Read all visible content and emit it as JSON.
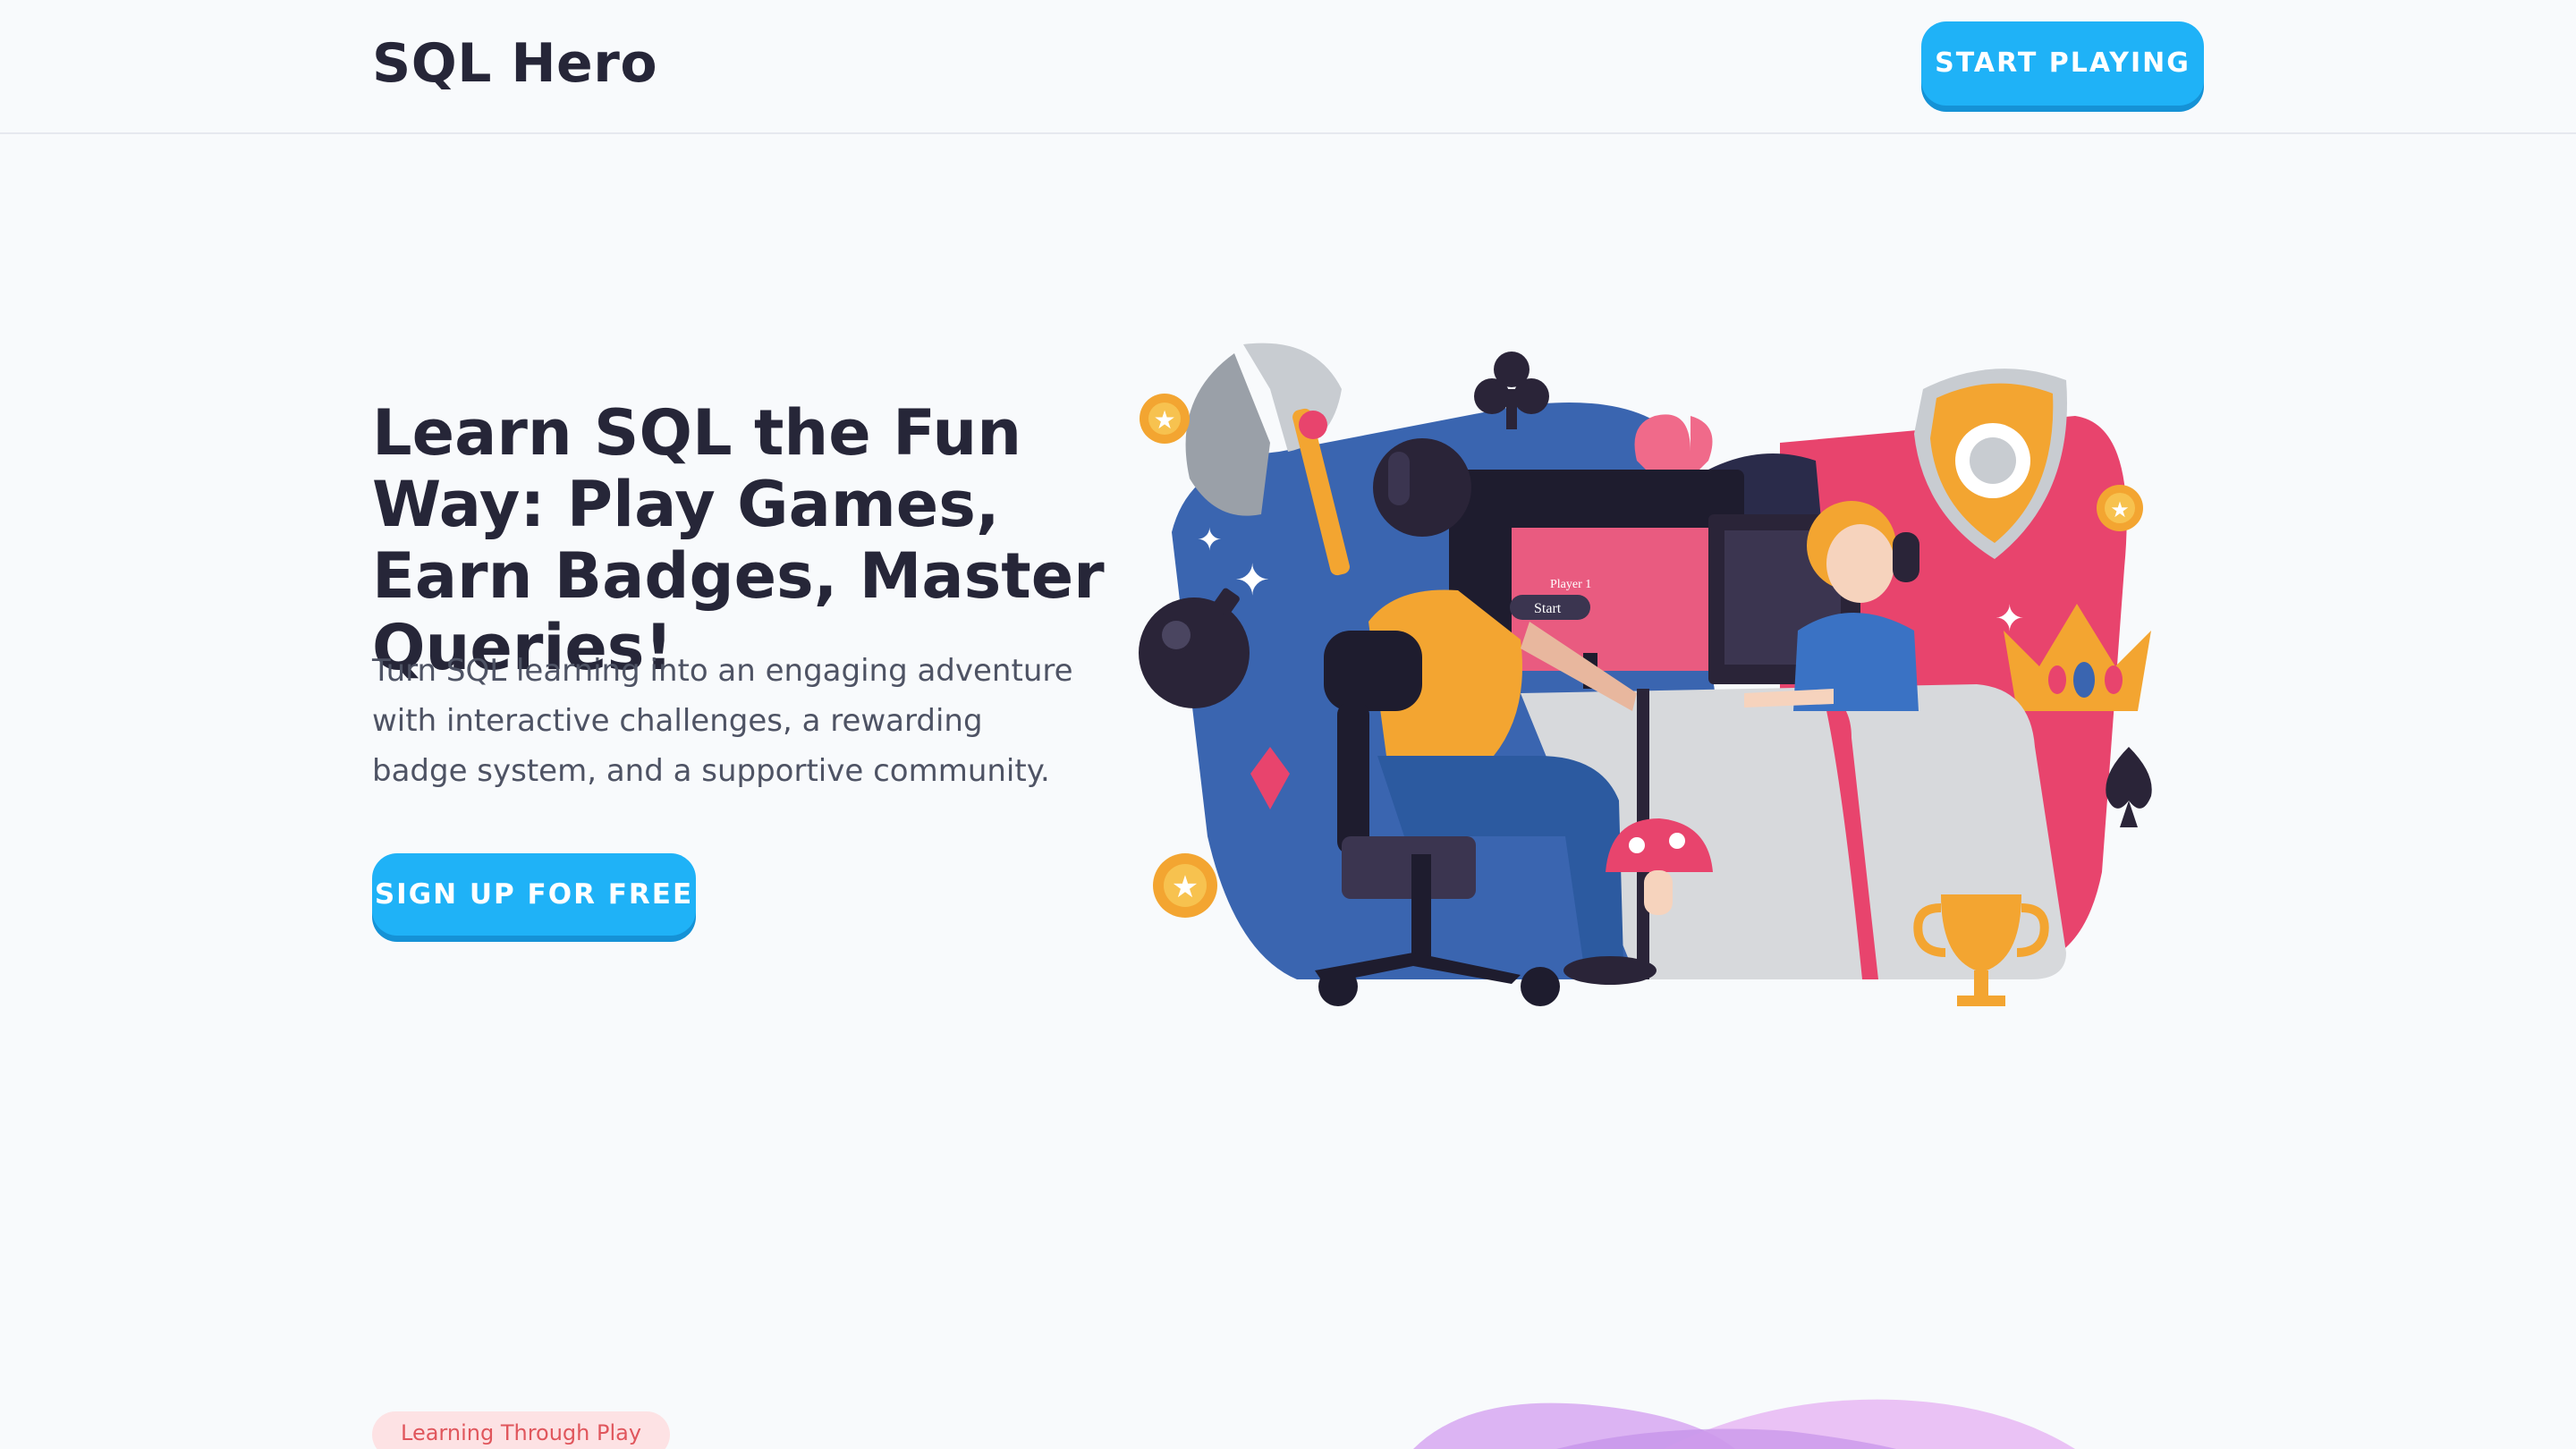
{
  "header": {
    "brand": "SQL Hero",
    "cta_label": "START PLAYING"
  },
  "hero": {
    "title": "Learn SQL the Fun Way: Play Games, Earn Badges, Master Queries!",
    "subtitle": "Turn SQL learning into an engaging adventure with interactive challenges, a rewarding badge system, and a supportive community.",
    "cta_label": "SIGN UP FOR FREE",
    "illustration": {
      "screen_label": "Player 1",
      "screen_button": "Start"
    }
  },
  "section": {
    "tag": "Learning Through Play"
  },
  "colors": {
    "accent": "#1fb2f7",
    "accent_shadow": "#1592d6",
    "blue_blob": "#3a65b0",
    "pink_blob": "#e8446d",
    "gold": "#f3a531",
    "dark": "#2a2438"
  }
}
